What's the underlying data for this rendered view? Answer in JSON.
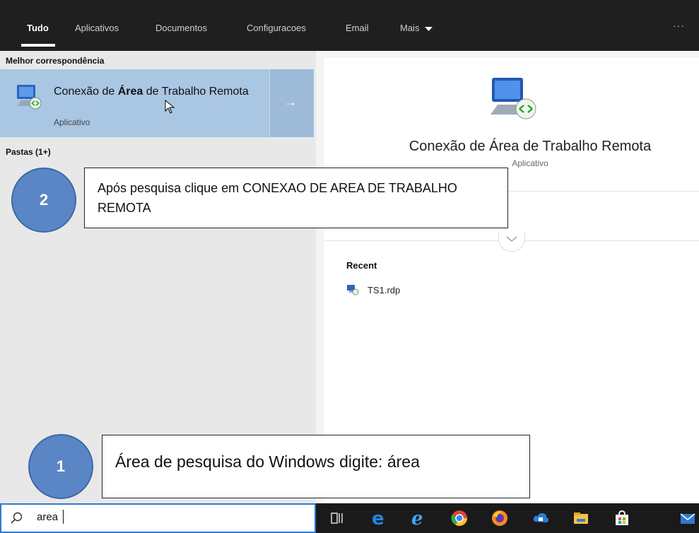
{
  "tabs": {
    "all": "Tudo",
    "apps": "Aplicativos",
    "documents": "Documentos",
    "settings": "Configuracoes",
    "email": "Email",
    "more": "Mais",
    "overflow": "···"
  },
  "left": {
    "best_match_header": "Melhor correspondência",
    "best_match": {
      "title_prefix": "Conexão de ",
      "title_bold": "Área",
      "title_suffix": " de Trabalho Remota",
      "type": "Aplicativo",
      "arrow": "→"
    },
    "folders_header": "Pastas (1+)"
  },
  "right": {
    "app_title": "Conexão de Área de Trabalho Remota",
    "app_type": "Aplicativo",
    "recent_header": "Recent",
    "recent_items": [
      "TS1.rdp"
    ]
  },
  "callouts": {
    "step2_number": "2",
    "step2_text": "Após pesquisa clique em CONEXAO DE AREA  DE TRABALHO REMOTA",
    "step1_number": "1",
    "step1_text": "Área de pesquisa do Windows digite:  área"
  },
  "search": {
    "value": "area"
  },
  "taskbar": {
    "icons": [
      "task-view-icon",
      "edge-icon",
      "internet-explorer-icon",
      "chrome-icon",
      "firefox-icon",
      "cloud-app-icon",
      "file-explorer-icon",
      "store-icon",
      "mail-icon"
    ]
  },
  "colors": {
    "accent": "#2f7ad0",
    "selection": "#a9c6e3",
    "callout_circle": "#5b86c6"
  }
}
